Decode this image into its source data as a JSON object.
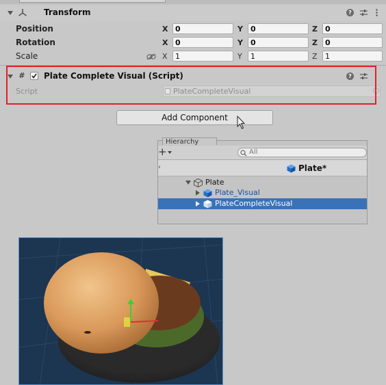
{
  "transform": {
    "title": "Transform",
    "position": {
      "label": "Position",
      "x": "0",
      "y": "0",
      "z": "0"
    },
    "rotation": {
      "label": "Rotation",
      "x": "0",
      "y": "0",
      "z": "0"
    },
    "scale": {
      "label": "Scale",
      "x": "1",
      "y": "1",
      "z": "1"
    },
    "axes": {
      "x": "X",
      "y": "Y",
      "z": "Z"
    }
  },
  "script_component": {
    "title": "Plate Complete Visual (Script)",
    "field_label": "Script",
    "field_value": "PlateCompleteVisual",
    "enabled": true,
    "highlight_color": "#e0202a"
  },
  "add_component": {
    "label": "Add Component"
  },
  "hierarchy": {
    "tab_label": "Hierarchy",
    "add_symbol": "+",
    "search_placeholder": "All",
    "scene_title": "Plate*",
    "items": [
      {
        "label": "Plate",
        "expanded": true
      },
      {
        "label": "Plate_Visual",
        "expanded": false
      },
      {
        "label": "PlateCompleteVisual",
        "expanded": false,
        "selected": true
      }
    ],
    "selection_color": "#3a72b8"
  },
  "colors": {
    "panel_bg": "#c8c8c8",
    "viewport_bg": "#1c3550",
    "prefab_blue": "#1f6fcf"
  }
}
